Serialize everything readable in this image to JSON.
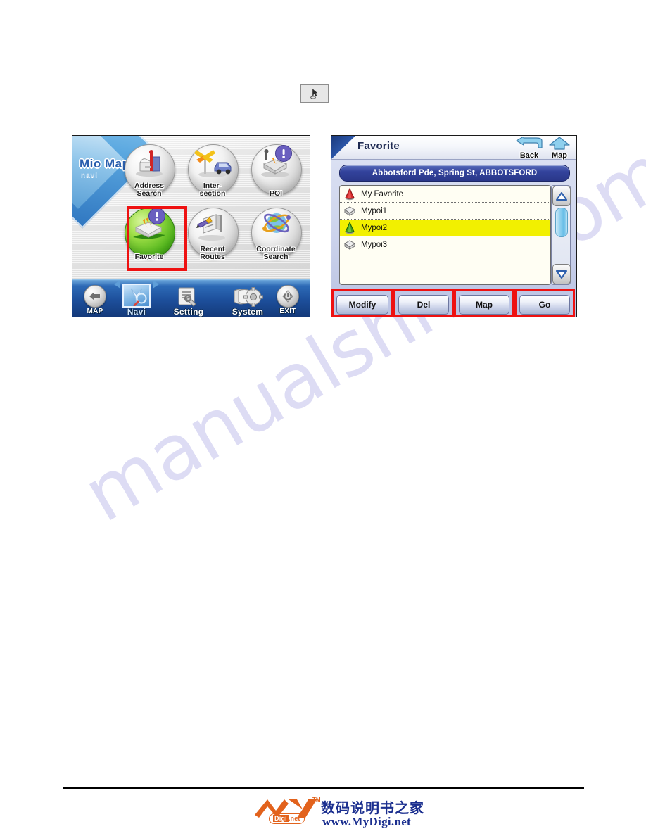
{
  "toolbar_button": {
    "icon": "cursor-arrow-icon"
  },
  "left_screen": {
    "name": "mio-map-navi-menu",
    "brand": {
      "logo": "Mio Map",
      "sub": "navi"
    },
    "menu_items": [
      {
        "label_line1": "Address",
        "label_line2": "Search",
        "icon": "mailbox-signpost-icon",
        "highlighted": false
      },
      {
        "label_line1": "Inter-",
        "label_line2": "section",
        "icon": "crossroad-car-icon",
        "highlighted": false
      },
      {
        "label_line1": "POI",
        "label_line2": "",
        "icon": "poi-exclamation-icon",
        "highlighted": false
      },
      {
        "label_line1": "Favorite",
        "label_line2": "",
        "icon": "favorite-box-exclamation-icon",
        "highlighted": true
      },
      {
        "label_line1": "Recent",
        "label_line2": "Routes",
        "icon": "recent-routes-book-icon",
        "highlighted": false
      },
      {
        "label_line1": "Coordinate",
        "label_line2": "Search",
        "icon": "globe-coordinate-icon",
        "highlighted": false
      }
    ],
    "taskbar": [
      {
        "label": "MAP",
        "icon": "back-arrow-icon",
        "active": false
      },
      {
        "label": "Navi",
        "icon": "navi-compass-icon",
        "active": true
      },
      {
        "label": "Setting",
        "icon": "settings-wrench-icon",
        "active": false
      },
      {
        "label": "System",
        "icon": "system-gear-shield-icon",
        "active": false
      },
      {
        "label": "EXIT",
        "icon": "power-exit-icon",
        "active": false
      }
    ]
  },
  "right_screen": {
    "name": "favorite-list-screen",
    "title": "Favorite",
    "top_buttons": [
      {
        "label": "Back",
        "icon": "back-curved-arrow-icon"
      },
      {
        "label": "Map",
        "icon": "map-up-arrow-icon"
      }
    ],
    "address_bar": "Abbotsford Pde, Spring St, ABBOTSFORD",
    "list_items": [
      {
        "label": "My Favorite",
        "icon": "red-cone-pin-icon",
        "selected": false
      },
      {
        "label": "Mypoi1",
        "icon": "grey-box-icon",
        "selected": false
      },
      {
        "label": "Mypoi2",
        "icon": "green-cone-pin-icon",
        "selected": true
      },
      {
        "label": "Mypoi3",
        "icon": "grey-box-icon",
        "selected": false
      },
      {
        "label": "",
        "icon": "",
        "selected": false
      },
      {
        "label": "",
        "icon": "",
        "selected": false
      }
    ],
    "scrollbar": {
      "up_icon": "triangle-up-icon",
      "down_icon": "triangle-down-icon"
    },
    "action_buttons": [
      {
        "label": "Modify",
        "highlighted": true
      },
      {
        "label": "Del",
        "highlighted": true
      },
      {
        "label": "Map",
        "highlighted": true
      },
      {
        "label": "Go",
        "highlighted": true
      }
    ]
  },
  "watermark": {
    "text": "manualshive.com"
  },
  "footer": {
    "logo_my": "My",
    "logo_tm": "TM",
    "logo_digi_1": "Digi",
    "logo_digi_2": ".net",
    "chinese": "数码说明书之家",
    "url": "www.MyDigi.net"
  },
  "colors": {
    "highlight_red": "#ee1111",
    "selected_yellow": "#f2f000",
    "brand_blue": "#2a5fae",
    "address_blue": "#33439c",
    "logo_orange": "#e2621c",
    "watermark_purple": "#c9c7ee"
  }
}
